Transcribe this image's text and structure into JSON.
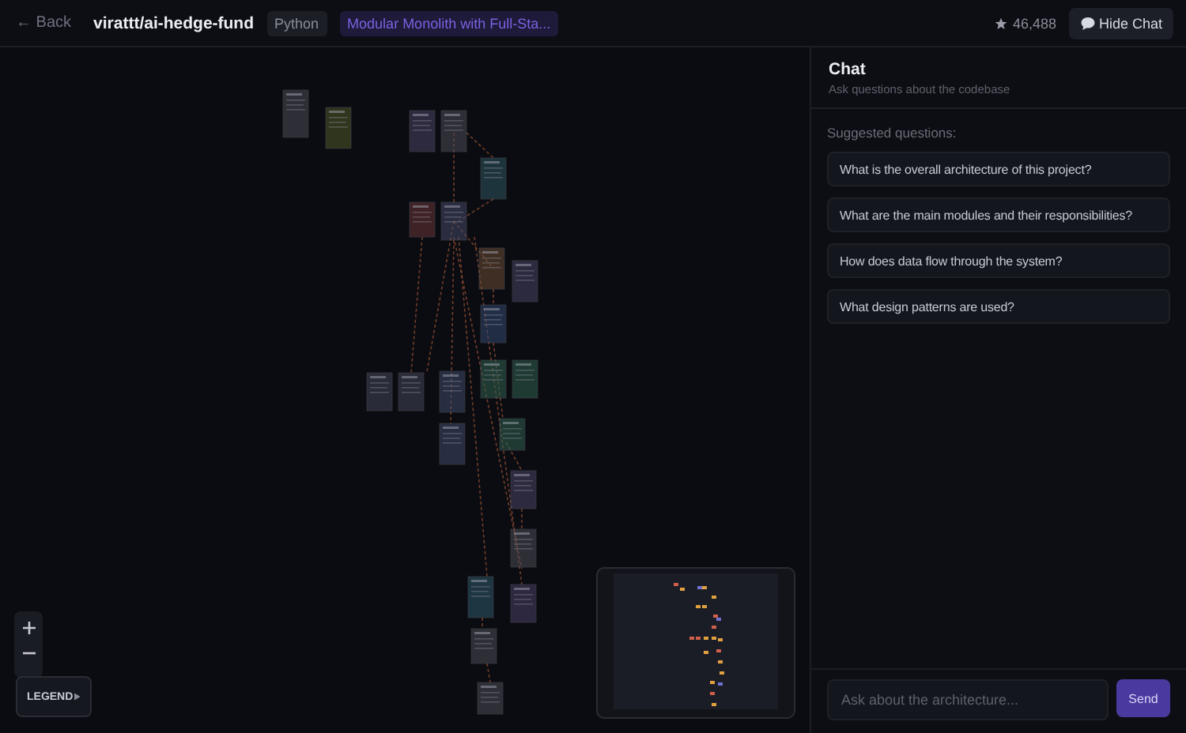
{
  "header": {
    "back": "← Back",
    "repo": "virattt/ai-hedge-fund",
    "language": "Python",
    "architecture": "Modular Monolith with Full-Sta...",
    "stars": "46,488",
    "hide_chat": "Hide Chat"
  },
  "canvas": {
    "legend": "LEGEND"
  },
  "chat": {
    "title": "Chat",
    "subtitle": "Ask questions about the codebase",
    "suggested_label": "Suggested questions:",
    "questions": [
      "What is the overall architecture of this project?",
      "What are the main modules and their responsibilities?",
      "How does data flow through the system?",
      "What design patterns are used?"
    ],
    "input": {
      "placeholder": "Ask about the architecture..."
    },
    "send": "Send"
  }
}
